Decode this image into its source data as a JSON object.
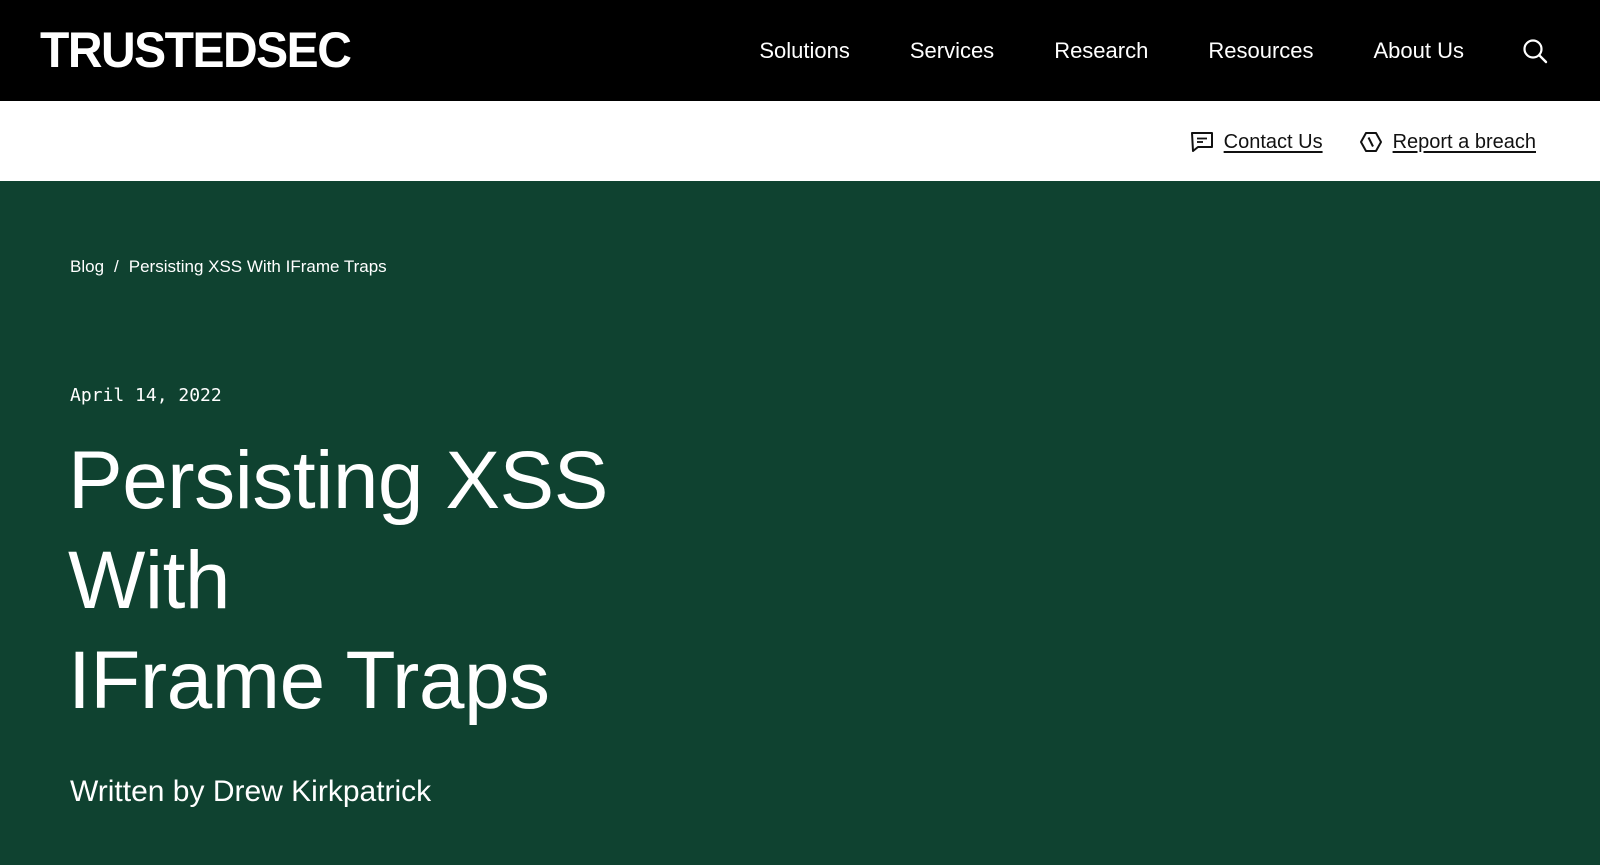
{
  "header": {
    "logo": "TRUSTEDSEC",
    "nav": [
      {
        "label": "Solutions"
      },
      {
        "label": "Services"
      },
      {
        "label": "Research"
      },
      {
        "label": "Resources"
      },
      {
        "label": "About Us"
      }
    ],
    "search_icon": "search-icon"
  },
  "utility": {
    "contact": {
      "label": "Contact Us",
      "icon": "chat-icon"
    },
    "breach": {
      "label": "Report a breach",
      "icon": "breach-icon"
    }
  },
  "breadcrumb": {
    "home": "Blog",
    "separator": "/",
    "current": "Persisting XSS With IFrame Traps"
  },
  "article": {
    "date": "April 14, 2022",
    "title_lines": [
      "Persisting XSS",
      "With",
      "IFrame Traps"
    ],
    "author": "Written by Drew Kirkpatrick"
  },
  "colors": {
    "topbar": "#000000",
    "utilbar": "#ffffff",
    "hero": "#0f4230",
    "text_on_dark": "#ffffff",
    "text_on_light": "#111111"
  }
}
